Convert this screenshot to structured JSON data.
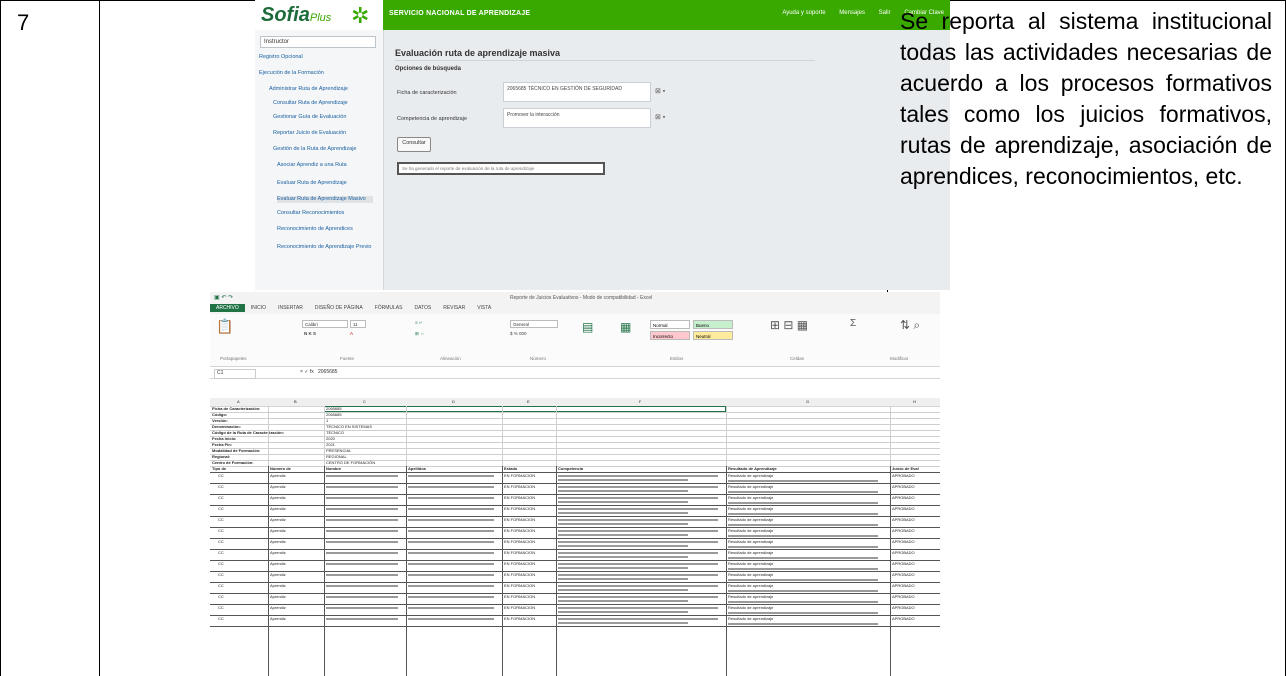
{
  "row": {
    "number": "7",
    "description": "Se reporta al sistema institucional todas las actividades necesarias de acuerdo a los procesos formativos tales como los juicios formativos, rutas de aprendizaje, asociación de aprendices, reconocimientos, etc."
  },
  "sofia": {
    "logo": "Sofia",
    "logo_suffix": "Plus",
    "org_name": "SERVICIO NACIONAL DE APRENDIZAJE",
    "top_links": [
      "Ayuda y soporte",
      "Mensajes",
      "Salir",
      "Cambiar Clave"
    ],
    "sidebar": {
      "select_value": "Instructor",
      "items": [
        "Registro Opcional",
        "Ejecución de la Formación",
        "Administrar Ruta de Aprendizaje",
        "Consultar Ruta de Aprendizaje",
        "Gestionar Guía de Evaluación",
        "Reportar Juicio de Evaluación",
        "Gestión de la Ruta de Aprendizaje",
        "Asociar Aprendiz a una Ruta",
        "Evaluar Ruta de Aprendizaje",
        "Evaluar Ruta de Aprendizaje Masivo",
        "Consultar Reconocimientos",
        "Reconocimiento de Aprendices",
        "Reconocimiento de Aprendizaje Previo"
      ]
    },
    "main": {
      "title": "Evaluación ruta de aprendizaje masiva",
      "subtitle": "Opciones de búsqueda",
      "field1_label": "Ficha de caracterización",
      "field1_value": "2065685 TÉCNICO EN GESTIÓN DE SEGURIDAD",
      "field2_label": "Competencia de aprendizaje",
      "field2_value": "Promover la interacción",
      "consult_button": "Consultar",
      "alert_text": "Se ha generado el reporte de evaluación de la ruta de aprendizaje"
    }
  },
  "excel": {
    "window_title": "Reporte de Juicios Evaluativos - Modo de compatibilidad - Excel",
    "tabs": [
      "ARCHIVO",
      "INICIO",
      "INSERTAR",
      "DISEÑO DE PÁGINA",
      "FÓRMULAS",
      "DATOS",
      "REVISAR",
      "VISTA"
    ],
    "ribbon": {
      "font_name": "Calibri",
      "font_size": "11",
      "styles": [
        "Normal",
        "Bueno",
        "Incorrecto",
        "Neutral"
      ],
      "style_colors": [
        "#ffffff",
        "#c6efce",
        "#ffc7ce",
        "#ffeb9c"
      ],
      "general_format": "General",
      "groups": [
        "Portapapeles",
        "Fuente",
        "Alineación",
        "Número",
        "Estilos",
        "Celdas",
        "Modificar"
      ]
    },
    "cell_ref": "C1",
    "formula_value": "2065685",
    "column_letters": [
      "A",
      "B",
      "C",
      "D",
      "E",
      "F",
      "G",
      "H"
    ],
    "header_info": [
      [
        "Ficha de Caracterización:",
        "2065685"
      ],
      [
        "Código:",
        "2065685"
      ],
      [
        "Versión:",
        "1"
      ],
      [
        "Denominación:",
        "TÉCNICO EN SISTEMAS"
      ],
      [
        "Código de la Ruta de Caracterización:",
        "TÉCNICO"
      ],
      [
        "Fecha Inicio:",
        "2020"
      ],
      [
        "Fecha Fin:",
        "2021"
      ],
      [
        "Modalidad de Formación:",
        "PRESENCIAL"
      ],
      [
        "Regional:",
        "REGIONAL"
      ],
      [
        "Centro de Formación:",
        "CENTRO DE FORMACIÓN"
      ]
    ],
    "table_headers": [
      "Tipo de",
      "Número de",
      "Nombre",
      "Apellidos",
      "Estado",
      "Competencia",
      "Resultado de Aprendizaje",
      "Juicio de Eval"
    ],
    "row_values": [
      "CC",
      "Aprendiz",
      "EN FORMACION",
      "Resultado de aprendizaje",
      "APROBADO"
    ]
  }
}
